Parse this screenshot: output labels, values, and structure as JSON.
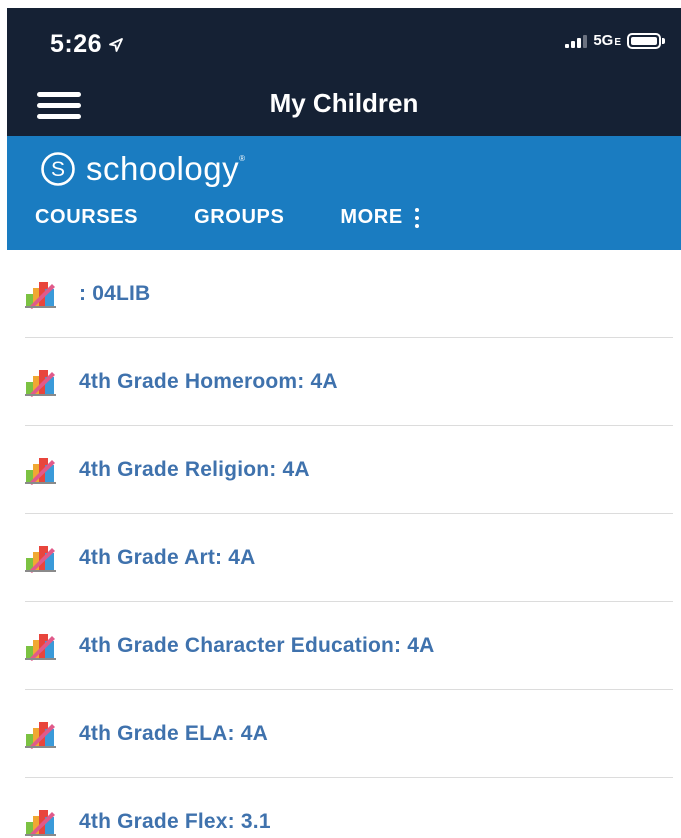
{
  "status_bar": {
    "time": "5:26",
    "network_main": "5G",
    "network_suffix": "E"
  },
  "header": {
    "title": "My Children"
  },
  "brand": {
    "name": "schoology",
    "trademark": "®"
  },
  "nav": {
    "courses": "COURSES",
    "groups": "GROUPS",
    "more": "MORE"
  },
  "courses": [
    {
      "label": ": 04LIB"
    },
    {
      "label": "4th Grade Homeroom: 4A"
    },
    {
      "label": "4th Grade Religion: 4A"
    },
    {
      "label": "4th Grade Art: 4A"
    },
    {
      "label": "4th Grade Character Education: 4A"
    },
    {
      "label": "4th Grade ELA: 4A"
    },
    {
      "label": "4th Grade Flex: 3.1"
    }
  ],
  "icons": {
    "location": "location-arrow-icon",
    "signal": "cellular-signal-icon",
    "battery": "battery-icon",
    "menu": "hamburger-menu-icon",
    "logo": "schoology-s-icon",
    "more": "kebab-vertical-icon",
    "course": "course-materials-icon"
  },
  "colors": {
    "topbar": "#152134",
    "brandbar": "#1a7cc1",
    "course_link": "#3f72ad"
  }
}
